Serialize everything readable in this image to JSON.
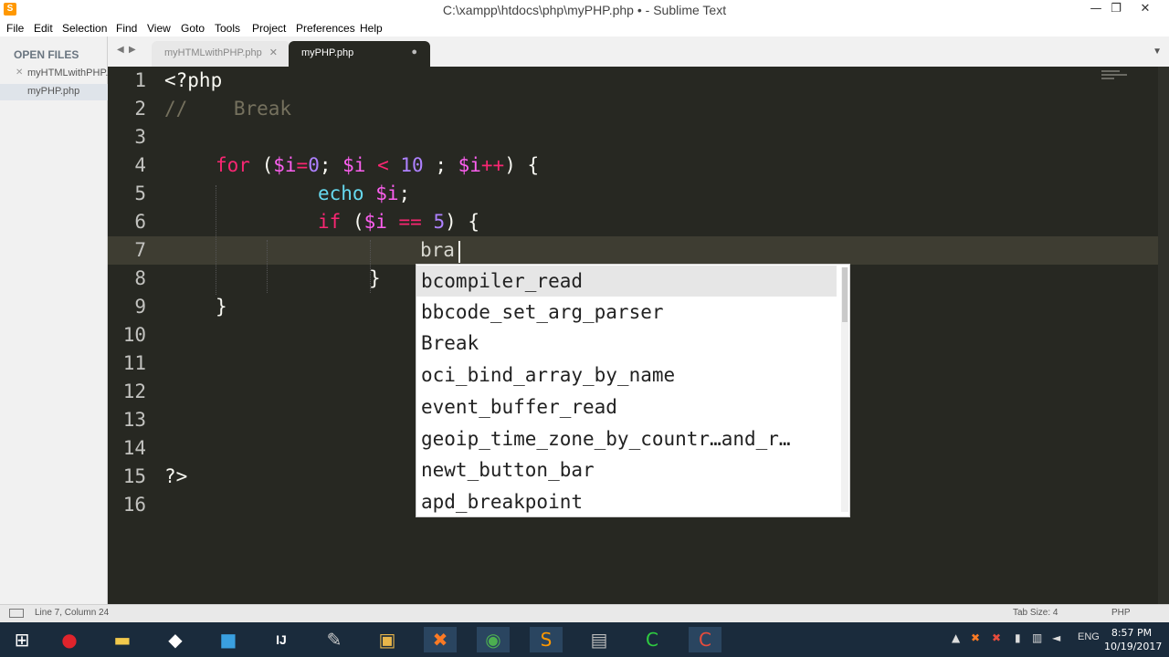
{
  "window": {
    "title": "C:\\xampp\\htdocs\\php\\myPHP.php • - Sublime Text",
    "minimize": "—",
    "maximize": "❐",
    "close": "✕"
  },
  "menu": [
    "File",
    "Edit",
    "Selection",
    "Find",
    "View",
    "Goto",
    "Tools",
    "Project",
    "Preferences",
    "Help"
  ],
  "sidebar": {
    "heading": "OPEN FILES",
    "files": [
      {
        "name": "myHTMLwithPHP.php",
        "close": "✕",
        "active": false
      },
      {
        "name": "myPHP.php",
        "close": "",
        "active": true
      }
    ]
  },
  "tabs": [
    {
      "label": "myHTMLwithPHP.php",
      "close": "✕",
      "active": false
    },
    {
      "label": "myPHP.php",
      "close": "●",
      "active": true
    }
  ],
  "editor": {
    "line_numbers": [
      "1",
      "2",
      "3",
      "4",
      "5",
      "6",
      "7",
      "8",
      "9",
      "10",
      "11",
      "12",
      "13",
      "14",
      "15",
      "16"
    ],
    "lines": {
      "l1": "<?php",
      "l2_comment": "//    Break",
      "l4_for": "for",
      "l4_rest": {
        "open": " (",
        "v1": "$i",
        "eq": "=",
        "n0": "0",
        "semi1": "; ",
        "v2": "$i",
        "lt": " < ",
        "n10": "10",
        "semi2": " ; ",
        "v3": "$i",
        "inc": "++",
        "close": ") {"
      },
      "l5": {
        "fn": "echo",
        "sp": " ",
        "var": "$i",
        "semi": ";"
      },
      "l6": {
        "kw": "if",
        "open": " (",
        "var": "$i",
        "op": " == ",
        "num": "5",
        "close": ") {"
      },
      "l7": "bra",
      "l8": "}",
      "l9": "}",
      "l15": "?>"
    },
    "current_line": 7
  },
  "autocomplete": [
    {
      "label": "bcompiler_read",
      "selected": true
    },
    {
      "label": "bbcode_set_arg_parser",
      "selected": false
    },
    {
      "label": "Break",
      "selected": false
    },
    {
      "label": "oci_bind_array_by_name",
      "selected": false
    },
    {
      "label": "event_buffer_read",
      "selected": false
    },
    {
      "label": "geoip_time_zone_by_countr…and_r…",
      "selected": false
    },
    {
      "label": "newt_button_bar",
      "selected": false
    },
    {
      "label": "apd_breakpoint",
      "selected": false
    }
  ],
  "status": {
    "position": "Line 7, Column 24",
    "tab_size": "Tab Size: 4",
    "syntax": "PHP"
  },
  "taskbar": {
    "start_icon": "windows-start-icon",
    "apps": [
      "opera-icon",
      "file-explorer-icon",
      "git-bash-icon",
      "outlook-icon",
      "intellij-icon",
      "paint-icon",
      "terminal-icon",
      "xampp-icon",
      "chrome-icon",
      "sublime-icon",
      "calculator-icon",
      "camtasia-icon",
      "camtasia-recorder-icon"
    ],
    "language": "ENG",
    "time": "8:57 PM",
    "date": "10/19/2017"
  },
  "colors": {
    "editor_bg": "#272822",
    "keyword": "#f92672",
    "variable": "#fd5ff0",
    "number": "#ae81ff",
    "comment": "#75715e",
    "function": "#66d9ef"
  }
}
